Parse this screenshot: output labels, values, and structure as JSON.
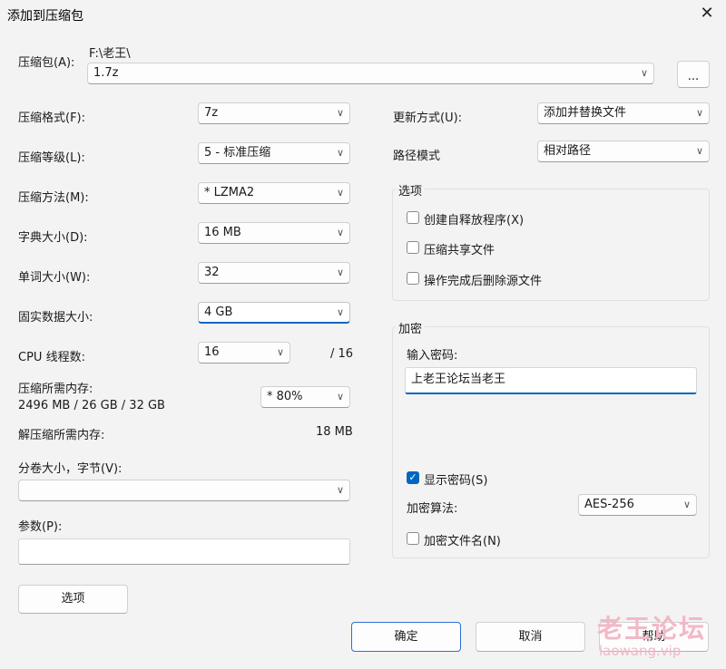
{
  "window": {
    "title": "添加到压缩包",
    "close_icon": "✕"
  },
  "archive": {
    "label": "压缩包(A):",
    "path": "F:\\老王\\",
    "name": "1.7z",
    "browse_label": "..."
  },
  "left": {
    "format": {
      "label": "压缩格式(F):",
      "value": "7z"
    },
    "level": {
      "label": "压缩等级(L):",
      "value": "5 - 标准压缩"
    },
    "method": {
      "label": "压缩方法(M):",
      "value": "*  LZMA2"
    },
    "dict": {
      "label": "字典大小(D):",
      "value": "16 MB"
    },
    "word": {
      "label": "单词大小(W):",
      "value": "32"
    },
    "solid": {
      "label": "固实数据大小:",
      "value": "4 GB"
    },
    "cpu": {
      "label": "CPU 线程数:",
      "value": "16",
      "max": "/ 16"
    },
    "mem_compress": {
      "label": "压缩所需内存:",
      "value": "2496 MB / 26 GB / 32 GB",
      "percent": "*  80%"
    },
    "mem_decompress": {
      "label": "解压缩所需内存:",
      "value": "18 MB"
    },
    "volume": {
      "label": "分卷大小，字节(V):",
      "value": ""
    },
    "params": {
      "label": "参数(P):",
      "value": ""
    },
    "options_button": "选项"
  },
  "right": {
    "update": {
      "label": "更新方式(U):",
      "value": "添加并替换文件"
    },
    "path_mode": {
      "label": "路径模式",
      "value": "相对路径"
    },
    "options_group": {
      "title": "选项",
      "sfx": "创建自释放程序(X)",
      "shared": "压缩共享文件",
      "delete": "操作完成后删除源文件"
    },
    "encryption": {
      "title": "加密",
      "password_label": "输入密码:",
      "password": "上老王论坛当老王",
      "show_password": "显示密码(S)",
      "method_label": "加密算法:",
      "method_value": "AES-256",
      "encrypt_names": "加密文件名(N)"
    }
  },
  "buttons": {
    "ok": "确定",
    "cancel": "取消",
    "help": "帮助"
  },
  "watermark": {
    "cn": "老王论坛",
    "url": "laowang.vip"
  },
  "icons": {
    "chevron": "∨",
    "check": "✓"
  }
}
